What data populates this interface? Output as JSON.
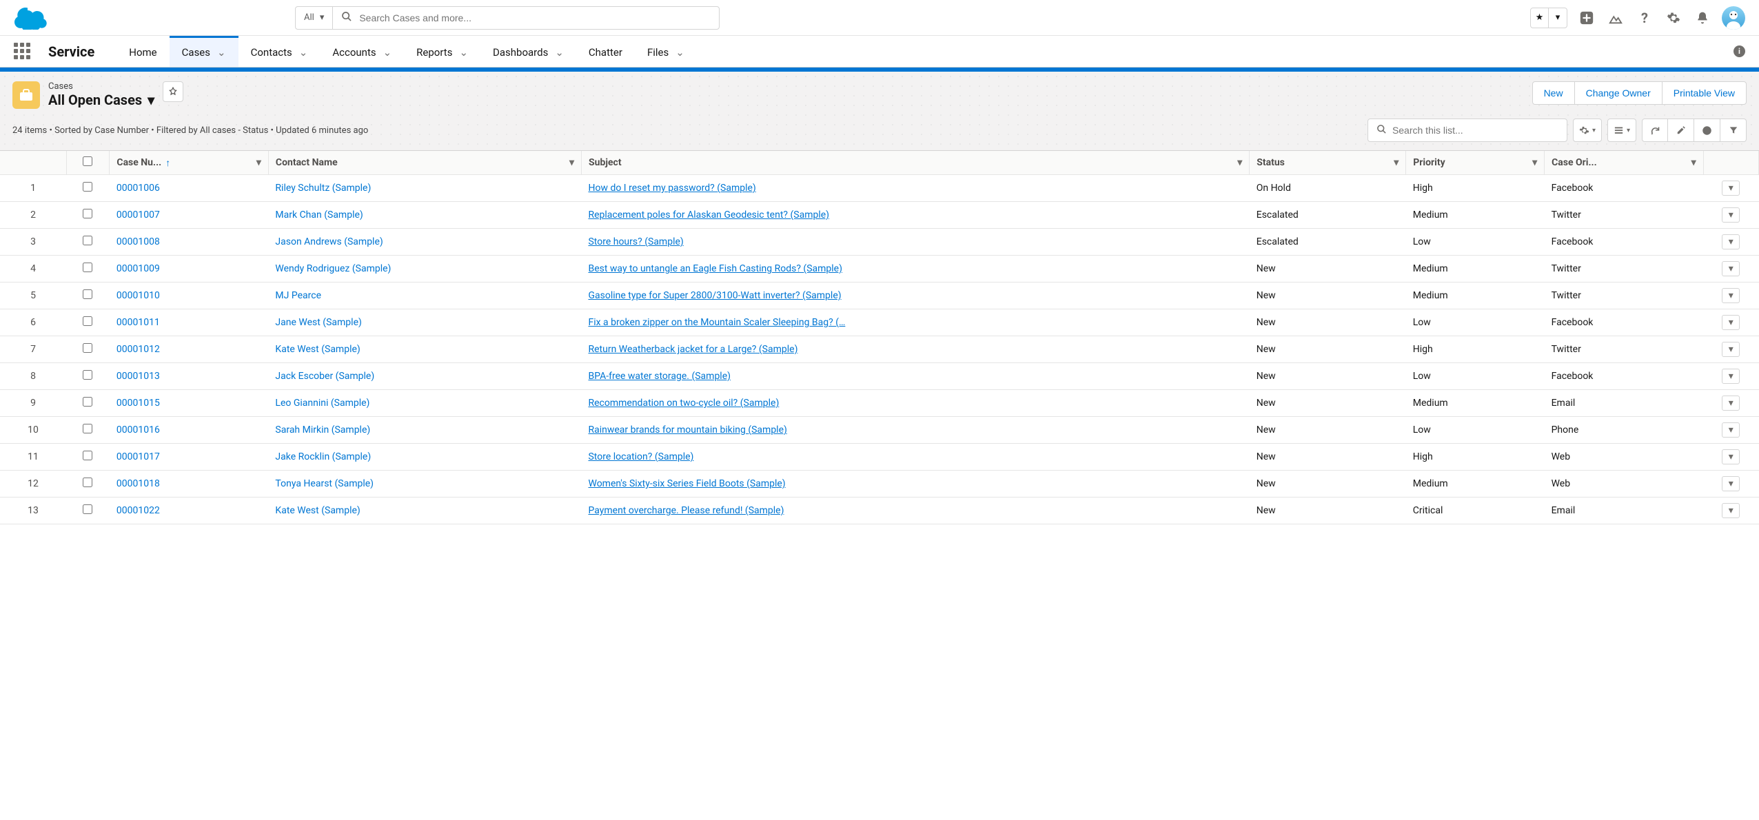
{
  "globalSearch": {
    "filter": "All",
    "placeholder": "Search Cases and more..."
  },
  "appName": "Service",
  "navTabs": [
    {
      "label": "Home",
      "chev": false,
      "active": false
    },
    {
      "label": "Cases",
      "chev": true,
      "active": true
    },
    {
      "label": "Contacts",
      "chev": true,
      "active": false
    },
    {
      "label": "Accounts",
      "chev": true,
      "active": false
    },
    {
      "label": "Reports",
      "chev": true,
      "active": false
    },
    {
      "label": "Dashboards",
      "chev": true,
      "active": false
    },
    {
      "label": "Chatter",
      "chev": false,
      "active": false
    },
    {
      "label": "Files",
      "chev": true,
      "active": false
    }
  ],
  "listHeader": {
    "object": "Cases",
    "viewName": "All Open Cases",
    "meta": "24 items • Sorted by Case Number • Filtered by All cases - Status • Updated 6 minutes ago",
    "searchPlaceholder": "Search this list...",
    "actions": {
      "new": "New",
      "changeOwner": "Change Owner",
      "printable": "Printable View"
    }
  },
  "columns": {
    "caseNo": "Case Nu...",
    "contact": "Contact Name",
    "subject": "Subject",
    "status": "Status",
    "priority": "Priority",
    "origin": "Case Ori..."
  },
  "rows": [
    {
      "n": "1",
      "caseNo": "00001006",
      "contact": "Riley Schultz (Sample)",
      "subject": "How do I reset my password? (Sample)",
      "status": "On Hold",
      "priority": "High",
      "origin": "Facebook"
    },
    {
      "n": "2",
      "caseNo": "00001007",
      "contact": "Mark Chan (Sample)",
      "subject": "Replacement poles for Alaskan Geodesic tent? (Sample)",
      "status": "Escalated",
      "priority": "Medium",
      "origin": "Twitter"
    },
    {
      "n": "3",
      "caseNo": "00001008",
      "contact": "Jason Andrews (Sample)",
      "subject": "Store hours? (Sample)",
      "status": "Escalated",
      "priority": "Low",
      "origin": "Facebook"
    },
    {
      "n": "4",
      "caseNo": "00001009",
      "contact": "Wendy Rodriguez (Sample)",
      "subject": "Best way to untangle an Eagle Fish Casting Rods? (Sample)",
      "status": "New",
      "priority": "Medium",
      "origin": "Twitter"
    },
    {
      "n": "5",
      "caseNo": "00001010",
      "contact": "MJ Pearce",
      "subject": "Gasoline type for Super 2800/3100-Watt inverter? (Sample)",
      "status": "New",
      "priority": "Medium",
      "origin": "Twitter"
    },
    {
      "n": "6",
      "caseNo": "00001011",
      "contact": "Jane West (Sample)",
      "subject": "Fix a broken zipper on the Mountain Scaler Sleeping Bag? (…",
      "status": "New",
      "priority": "Low",
      "origin": "Facebook"
    },
    {
      "n": "7",
      "caseNo": "00001012",
      "contact": "Kate West (Sample)",
      "subject": "Return Weatherback jacket for a Large? (Sample)",
      "status": "New",
      "priority": "High",
      "origin": "Twitter"
    },
    {
      "n": "8",
      "caseNo": "00001013",
      "contact": "Jack Escober (Sample)",
      "subject": "BPA-free water storage. (Sample)",
      "status": "New",
      "priority": "Low",
      "origin": "Facebook"
    },
    {
      "n": "9",
      "caseNo": "00001015",
      "contact": "Leo Giannini (Sample)",
      "subject": "Recommendation on two-cycle oil? (Sample)",
      "status": "New",
      "priority": "Medium",
      "origin": "Email"
    },
    {
      "n": "10",
      "caseNo": "00001016",
      "contact": "Sarah Mirkin (Sample)",
      "subject": "Rainwear brands for mountain biking (Sample)",
      "status": "New",
      "priority": "Low",
      "origin": "Phone"
    },
    {
      "n": "11",
      "caseNo": "00001017",
      "contact": "Jake Rocklin (Sample)",
      "subject": "Store location? (Sample)",
      "status": "New",
      "priority": "High",
      "origin": "Web"
    },
    {
      "n": "12",
      "caseNo": "00001018",
      "contact": "Tonya Hearst (Sample)",
      "subject": "Women's Sixty-six Series Field Boots (Sample)",
      "status": "New",
      "priority": "Medium",
      "origin": "Web"
    },
    {
      "n": "13",
      "caseNo": "00001022",
      "contact": "Kate West (Sample)",
      "subject": "Payment overcharge. Please refund! (Sample)",
      "status": "New",
      "priority": "Critical",
      "origin": "Email"
    }
  ]
}
